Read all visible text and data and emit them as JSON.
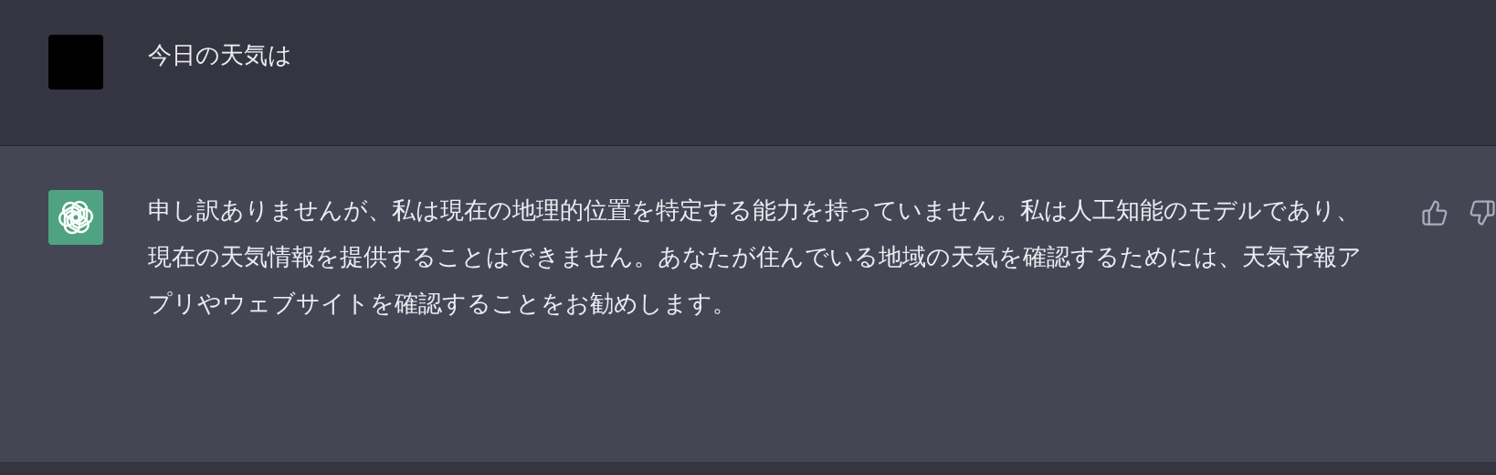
{
  "messages": [
    {
      "kind": "user",
      "text": "今日の天気は"
    },
    {
      "kind": "assistant",
      "text": "申し訳ありませんが、私は現在の地理的位置を特定する能力を持っていません。私は人工知能のモデルであり、現在の天気情報を提供することはできません。あなたが住んでいる地域の天気を確認するためには、天気予報アプリやウェブサイトを確認することをお勧めします。"
    }
  ]
}
